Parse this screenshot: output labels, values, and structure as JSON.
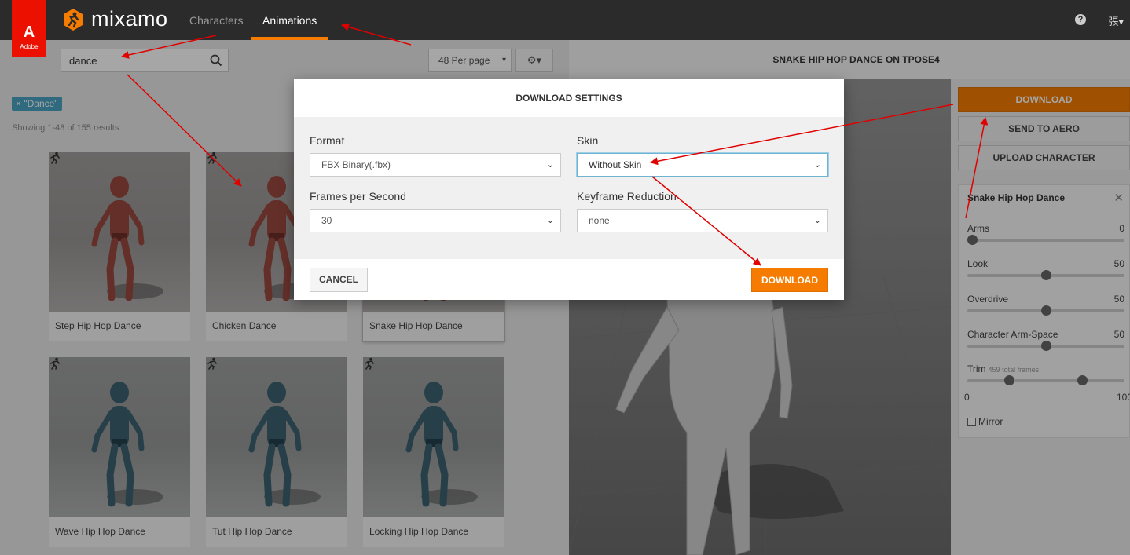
{
  "nav": {
    "adobe_label": "Adobe",
    "brand": "mixamo",
    "tabs": [
      "Characters",
      "Animations"
    ],
    "active_tab": "Animations",
    "user": "張"
  },
  "search": {
    "value": "dance"
  },
  "toolbar": {
    "per_page": "48 Per page"
  },
  "filter": {
    "tag": "× \"Dance\""
  },
  "results": {
    "count_text": "Showing 1-48 of 155 results"
  },
  "animations": [
    {
      "name": "Step Hip Hop Dance",
      "model": "red"
    },
    {
      "name": "Chicken Dance",
      "model": "red"
    },
    {
      "name": "Snake Hip Hop Dance",
      "model": "red",
      "selected": true
    },
    {
      "name": "Wave Hip Hop Dance",
      "model": "teal"
    },
    {
      "name": "Tut Hip Hop Dance",
      "model": "teal"
    },
    {
      "name": "Locking Hip Hop Dance",
      "model": "teal"
    }
  ],
  "preview": {
    "title": "SNAKE HIP HOP DANCE ON TPOSE4"
  },
  "right_panel": {
    "download": "DOWNLOAD",
    "send_to_aero": "SEND TO AERO",
    "upload_character": "UPLOAD CHARACTER",
    "settings_title": "Snake Hip Hop Dance",
    "sliders": [
      {
        "label": "Arms",
        "value": "0",
        "fraction": 0
      },
      {
        "label": "Look",
        "value": "50",
        "fraction": 0.5
      },
      {
        "label": "Overdrive",
        "value": "50",
        "fraction": 0.5
      },
      {
        "label": "Character Arm-Space",
        "value": "50",
        "fraction": 0.5
      }
    ],
    "trim": {
      "label": "Trim",
      "sub": "459 total frames",
      "min": "0",
      "max": "100",
      "start_fraction": 0.25,
      "end_fraction": 0.75
    },
    "mirror": "Mirror"
  },
  "modal": {
    "title": "DOWNLOAD SETTINGS",
    "format_label": "Format",
    "format_value": "FBX Binary(.fbx)",
    "skin_label": "Skin",
    "skin_value": "Without Skin",
    "fps_label": "Frames per Second",
    "fps_value": "30",
    "keyframe_label": "Keyframe Reduction",
    "keyframe_value": "none",
    "cancel": "CANCEL",
    "download": "DOWNLOAD"
  },
  "colors": {
    "accent": "#f57c00",
    "topbar": "#2b2b2b",
    "adobe_red": "#eb1000",
    "tag": "#4aa3c2",
    "annotation_arrow": "#e00000"
  }
}
